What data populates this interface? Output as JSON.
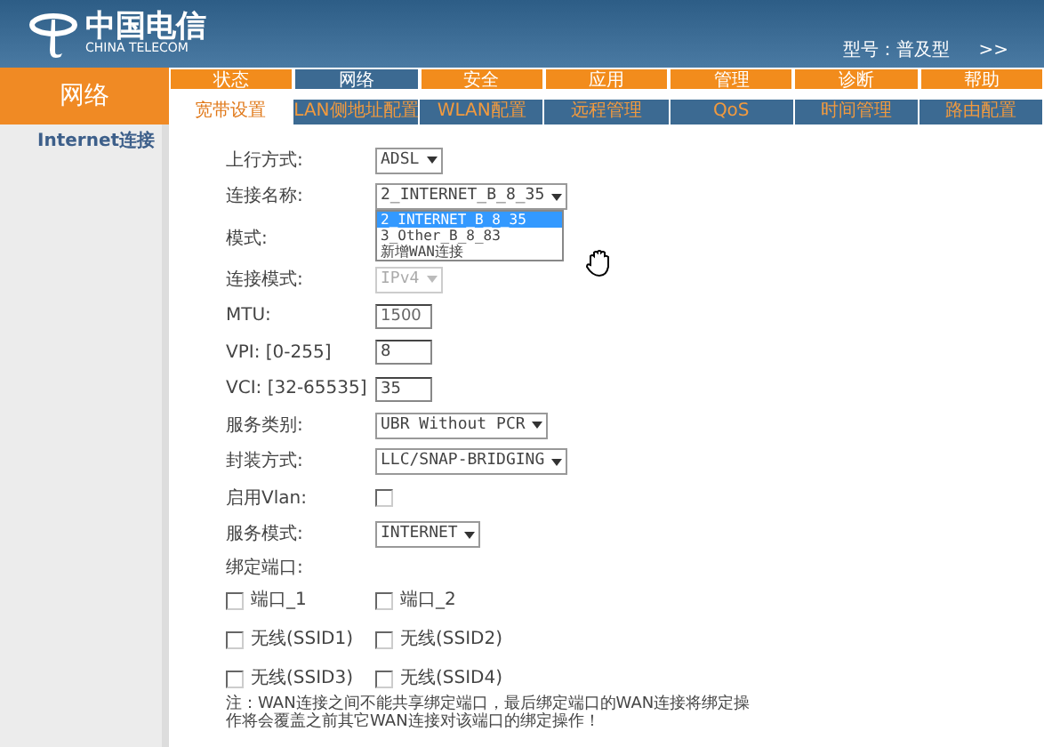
{
  "header": {
    "logo_cn": "中国电信",
    "logo_en": "CHINA TELECOM",
    "model": "型号：普及型",
    "more": ">>"
  },
  "section_title": "网络",
  "main_tabs": [
    {
      "label": "状态",
      "selected": false
    },
    {
      "label": "网络",
      "selected": true
    },
    {
      "label": "安全",
      "selected": false
    },
    {
      "label": "应用",
      "selected": false
    },
    {
      "label": "管理",
      "selected": false
    },
    {
      "label": "诊断",
      "selected": false
    },
    {
      "label": "帮助",
      "selected": false
    }
  ],
  "sub_tabs": [
    {
      "label": "宽带设置",
      "selected": true
    },
    {
      "label": "LAN侧地址配置",
      "selected": false
    },
    {
      "label": "WLAN配置",
      "selected": false
    },
    {
      "label": "远程管理",
      "selected": false
    },
    {
      "label": "QoS",
      "selected": false
    },
    {
      "label": "时间管理",
      "selected": false
    },
    {
      "label": "路由配置",
      "selected": false
    }
  ],
  "sidebar": {
    "items": [
      {
        "label": "Internet连接"
      }
    ]
  },
  "form": [
    {
      "kind": "select",
      "label": "上行方式:",
      "value": "ADSL",
      "disabled": false
    },
    {
      "kind": "select",
      "label": "连接名称:",
      "value": "2_INTERNET_B_8_35",
      "disabled": false,
      "expanded": true,
      "options": [
        {
          "label": "2_INTERNET_B_8_35",
          "selected": true
        },
        {
          "label": "3_Other_B_8_83",
          "selected": false
        },
        {
          "label": "新增WAN连接",
          "selected": false
        }
      ]
    },
    {
      "kind": "label",
      "label": "模式:"
    },
    {
      "kind": "select",
      "label": "连接模式:",
      "value": "IPv4",
      "disabled": true
    },
    {
      "kind": "input",
      "label": "MTU:",
      "value": "1500",
      "disabled": true
    },
    {
      "kind": "input",
      "label": "VPI: [0-255]",
      "value": "8",
      "disabled": false
    },
    {
      "kind": "input",
      "label": "VCI: [32-65535]",
      "value": "35",
      "disabled": false
    },
    {
      "kind": "select",
      "label": "服务类别:",
      "value": "UBR Without PCR",
      "disabled": false
    },
    {
      "kind": "select",
      "label": "封装方式:",
      "value": "LLC/SNAP-BRIDGING",
      "disabled": false
    },
    {
      "kind": "checkbox",
      "label": "启用Vlan:",
      "checked": false
    },
    {
      "kind": "select",
      "label": "服务模式:",
      "value": "INTERNET",
      "disabled": false
    },
    {
      "kind": "label",
      "label": "绑定端口:"
    }
  ],
  "ports": [
    {
      "label": "端口_1",
      "checked": false
    },
    {
      "label": "端口_2",
      "checked": false
    },
    {
      "label": "无线(SSID1)",
      "checked": false
    },
    {
      "label": "无线(SSID2)",
      "checked": false
    },
    {
      "label": "无线(SSID3)",
      "checked": false
    },
    {
      "label": "无线(SSID4)",
      "checked": false
    }
  ],
  "note": "注：WAN连接之间不能共享绑定端口，最后绑定端口的WAN连接将绑定操作将会覆盖之前其它WAN连接对该端口的绑定操作！"
}
